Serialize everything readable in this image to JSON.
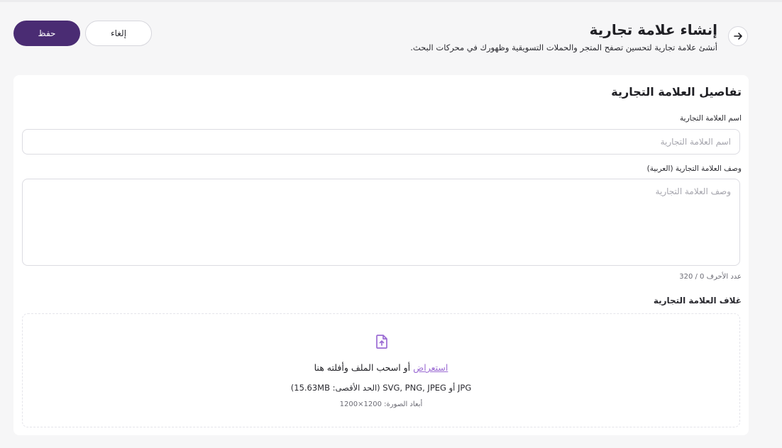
{
  "header": {
    "title": "إنشاء علامة تجارية",
    "subtitle": "أنشئ علامة تجارية لتحسين تصفح المتجر والحملات التسويقية وظهورك في محركات البحث.",
    "back_icon": "arrow-right-icon",
    "save_label": "حفظ",
    "cancel_label": "إلغاء"
  },
  "colors": {
    "primary": "#4a2c73",
    "link": "#9b6bd3",
    "background": "#f6f6f7"
  },
  "form": {
    "section_title": "تفاصيل العلامة التجارية",
    "name_label": "اسم العلامة التجارية",
    "name_placeholder": "اسم العلامة التجارية",
    "name_value": "",
    "desc_label": "وصف العلامة التجارية (العربية)",
    "desc_placeholder": "وصف العلامة التجارية",
    "desc_value": "",
    "char_count": "عدد الأحرف 0 / 320",
    "cover_label": "غلاف العلامة التجارية"
  },
  "upload": {
    "icon": "file-upload-icon",
    "browse_label": "استعراض",
    "drag_text": "أو اسحب الملف وأفلته هنا",
    "formats_text": "JPG أو SVG, PNG, JPEG (الحد الأقصى: 15.63MB)",
    "dimensions_text": "أبعاد الصورة: 1200×1200"
  }
}
